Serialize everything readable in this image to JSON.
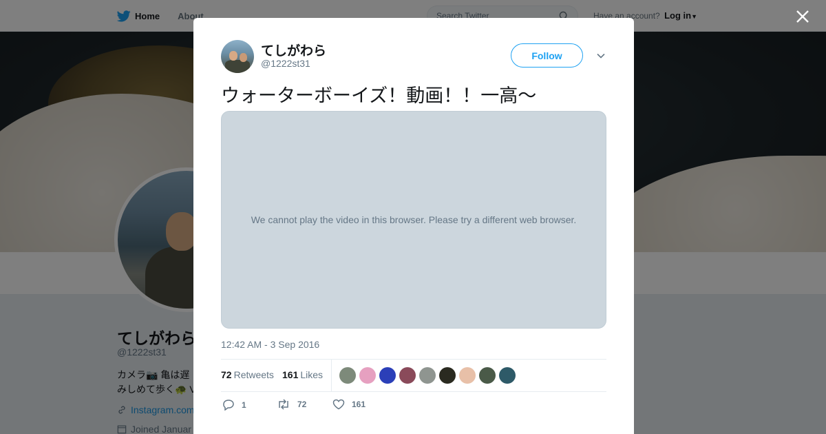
{
  "topbar": {
    "home_label": "Home",
    "about_label": "About",
    "search_placeholder": "Search Twitter",
    "account_prompt": "Have an account?",
    "login_label": "Log in"
  },
  "profile": {
    "name": "てしがわら",
    "handle": "@1222st31",
    "bio_line1": "カメラ📷 亀は遅",
    "bio_line2": "みしめて歩く🐢 V",
    "link": "Instagram.com",
    "joined": "Joined Januar"
  },
  "tweet": {
    "author_name": "てしがわら",
    "author_handle": "@1222st31",
    "follow_label": "Follow",
    "text": "ウォーターボーイズ！動画！！一高〜",
    "video_message": "We cannot play the video in this browser. Please try a different web browser.",
    "timestamp": "12:42 AM - 3 Sep 2016",
    "retweets_count": "72",
    "retweets_label": "Retweets",
    "likes_count": "161",
    "likes_label": "Likes",
    "reply_count": "1",
    "retweet_action_count": "72",
    "like_action_count": "161",
    "liker_colors": [
      "#7d8a7a",
      "#e6a0c0",
      "#2b3fb8",
      "#8a4a5a",
      "#8f9590",
      "#2a2a20",
      "#e8c0a8",
      "#4a5a48",
      "#2e5a68"
    ]
  },
  "colors": {
    "accent": "#1da1f2",
    "text_primary": "#14171a",
    "text_secondary": "#657786"
  }
}
